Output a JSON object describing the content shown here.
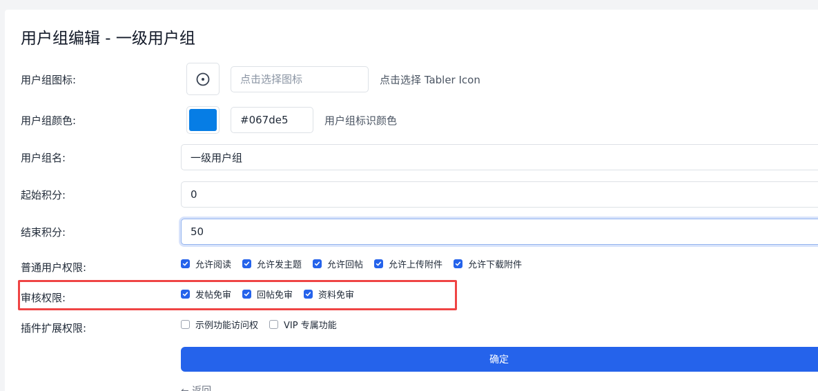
{
  "page": {
    "title": "用户组编辑 - 一级用户组"
  },
  "form": {
    "icon": {
      "label": "用户组图标:",
      "icon_name": "circle-dot-icon",
      "placeholder": "点击选择图标",
      "hint": "点击选择 Tabler Icon"
    },
    "color": {
      "label": "用户组颜色:",
      "value": "#067de5",
      "swatch_color": "#067de5",
      "hint": "用户组标识颜色"
    },
    "name": {
      "label": "用户组名:",
      "value": "一级用户组"
    },
    "start_points": {
      "label": "起始积分:",
      "value": "0"
    },
    "end_points": {
      "label": "结束积分:",
      "value": "50"
    },
    "user_permissions": {
      "label": "普通用户权限:",
      "options": [
        {
          "label": "允许阅读",
          "checked": true
        },
        {
          "label": "允许发主题",
          "checked": true
        },
        {
          "label": "允许回帖",
          "checked": true
        },
        {
          "label": "允许上传附件",
          "checked": true
        },
        {
          "label": "允许下载附件",
          "checked": true
        }
      ]
    },
    "review_permissions": {
      "label": "审核权限:",
      "options": [
        {
          "label": "发帖免审",
          "checked": true
        },
        {
          "label": "回帖免审",
          "checked": true
        },
        {
          "label": "资料免审",
          "checked": true
        }
      ]
    },
    "plugin_permissions": {
      "label": "插件扩展权限:",
      "options": [
        {
          "label": "示例功能访问权",
          "checked": false
        },
        {
          "label": "VIP 专属功能",
          "checked": false
        }
      ]
    },
    "submit_label": "确定",
    "back_label": "← 返回"
  },
  "colors": {
    "primary": "#2563eb",
    "highlight": "#ef4444"
  }
}
